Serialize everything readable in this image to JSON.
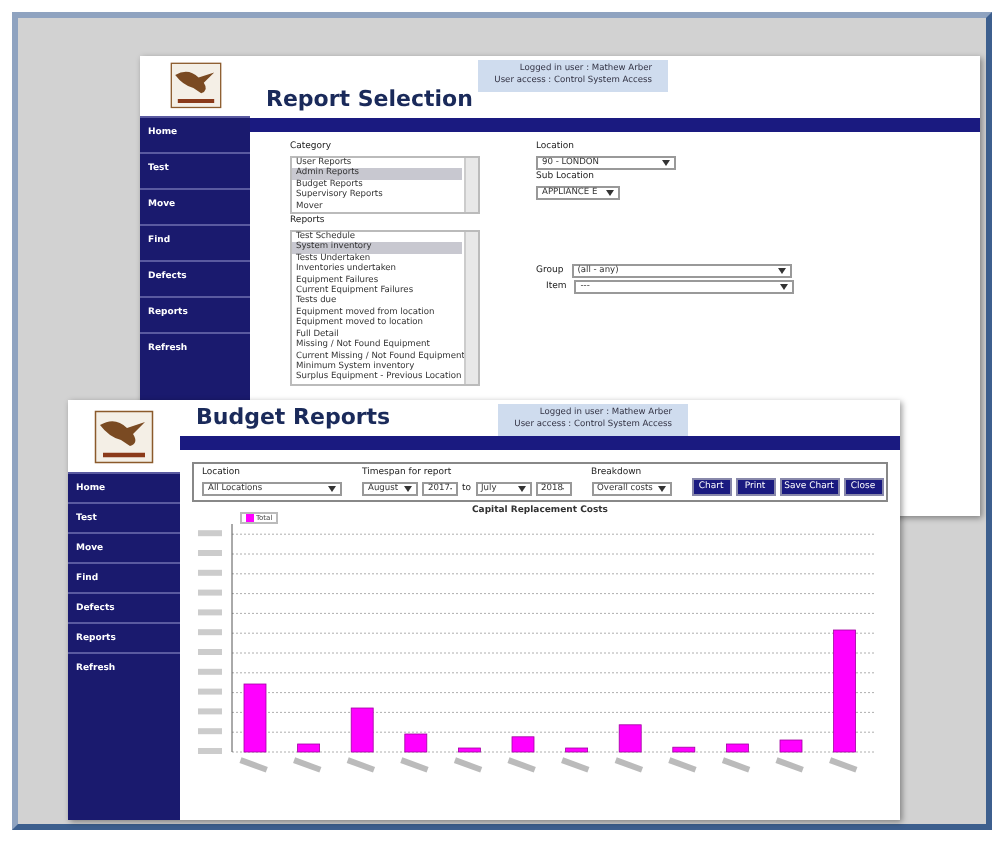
{
  "report_selection": {
    "title": "Report Selection",
    "user_info": [
      "Logged in user :  Mathew Arber",
      "User access :  Control System Access"
    ],
    "sidebar": [
      {
        "label": "Home"
      },
      {
        "label": "Test"
      },
      {
        "label": "Move"
      },
      {
        "label": "Find"
      },
      {
        "label": "Defects"
      },
      {
        "label": "Reports"
      },
      {
        "label": "Refresh"
      }
    ],
    "category": {
      "label": "Category",
      "items": [
        {
          "label": "User Reports",
          "selected": false
        },
        {
          "label": "Admin Reports",
          "selected": true
        },
        {
          "label": "Budget Reports",
          "selected": false
        },
        {
          "label": "Supervisory Reports",
          "selected": false
        },
        {
          "label": "Mover",
          "selected": false
        }
      ]
    },
    "reports": {
      "label": "Reports",
      "items": [
        {
          "label": "Test Schedule",
          "selected": false
        },
        {
          "label": "System inventory",
          "selected": true
        },
        {
          "label": "Tests Undertaken",
          "selected": false
        },
        {
          "label": "Inventories undertaken",
          "selected": false
        },
        {
          "label": "Equipment Failures",
          "selected": false
        },
        {
          "label": "Current Equipment Failures",
          "selected": false
        },
        {
          "label": "Tests due",
          "selected": false
        },
        {
          "label": "Equipment moved from location",
          "selected": false
        },
        {
          "label": "Equipment moved to location",
          "selected": false
        },
        {
          "label": "Full Detail",
          "selected": false
        },
        {
          "label": "Missing / Not Found Equipment",
          "selected": false
        },
        {
          "label": "Current Missing / Not Found Equipment",
          "selected": false
        },
        {
          "label": "Minimum System inventory",
          "selected": false
        },
        {
          "label": "Surplus Equipment - Previous Location",
          "selected": false
        }
      ]
    },
    "location": {
      "label": "Location",
      "value": "90 - LONDON"
    },
    "sub_location": {
      "label": "Sub Location",
      "value": "APPLIANCE E"
    },
    "group": {
      "label": "Group",
      "value": "(all - any)"
    },
    "item": {
      "label": "Item",
      "value": "---"
    }
  },
  "budget_reports": {
    "title": "Budget Reports",
    "user_info": [
      "Logged in user :  Mathew Arber",
      "User access :  Control System Access"
    ],
    "sidebar": [
      {
        "label": "Home"
      },
      {
        "label": "Test"
      },
      {
        "label": "Move"
      },
      {
        "label": "Find"
      },
      {
        "label": "Defects"
      },
      {
        "label": "Reports"
      },
      {
        "label": "Refresh"
      }
    ],
    "location": {
      "label": "Location",
      "value": "All Locations"
    },
    "timespan": {
      "label": "Timespan for report",
      "from_month": "August",
      "from_year": "2017",
      "to": "to",
      "to_month": "July",
      "to_year": "2018"
    },
    "breakdown": {
      "label": "Breakdown",
      "value": "Overall costs"
    },
    "buttons": [
      "Chart",
      "Print",
      "Save Chart",
      "Close"
    ],
    "chart": {
      "title": "Capital Replacement Costs",
      "legend": "Total"
    }
  }
}
